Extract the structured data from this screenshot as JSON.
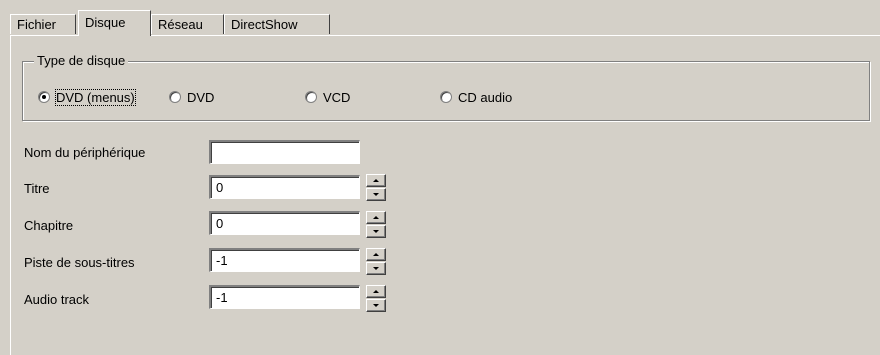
{
  "tabs": [
    "Fichier",
    "Disque",
    "Réseau",
    "DirectShow"
  ],
  "active_tab": "Disque",
  "disc_type": {
    "legend": "Type de disque",
    "options": [
      "DVD (menus)",
      "DVD",
      "VCD",
      "CD audio"
    ],
    "selected": "DVD (menus)"
  },
  "fields": {
    "device": {
      "label": "Nom du périphérique",
      "value": ""
    },
    "title": {
      "label": "Titre",
      "value": "0"
    },
    "chapter": {
      "label": "Chapitre",
      "value": "0"
    },
    "subtitle_track": {
      "label": "Piste de sous-titres",
      "value": "-1"
    },
    "audio_track": {
      "label": "Audio track",
      "value": "-1"
    }
  }
}
